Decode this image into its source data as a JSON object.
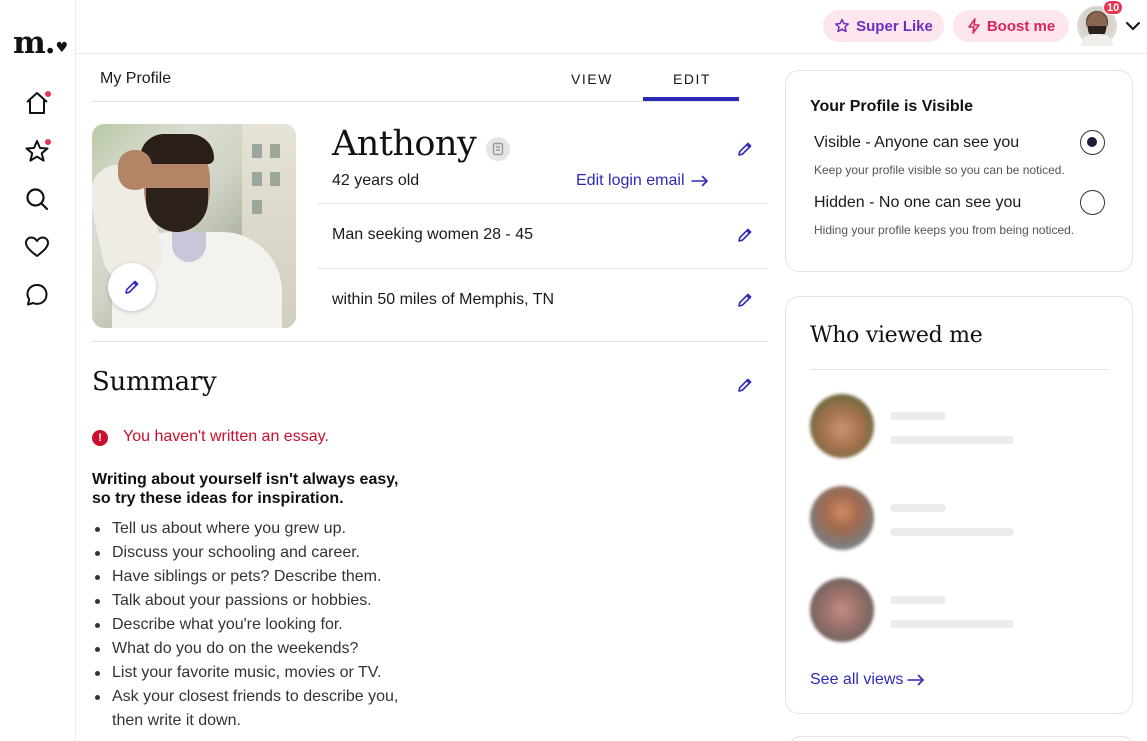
{
  "brand": {
    "logo": "m."
  },
  "topbar": {
    "super_like_label": "Super Like",
    "boost_label": "Boost me",
    "notification_count": "10"
  },
  "tabs": {
    "page_label": "My Profile",
    "view_label": "VIEW",
    "edit_label": "EDIT",
    "active": "EDIT"
  },
  "profile": {
    "name": "Anthony",
    "age": "42 years old",
    "login_email_link": "Edit login email",
    "seeking": "Man seeking women 28 - 45",
    "location": "within 50 miles of Memphis, TN"
  },
  "summary": {
    "title": "Summary",
    "warning": "You haven't written an essay.",
    "ideas_heading_line1": "Writing about yourself isn't always easy,",
    "ideas_heading_line2": "so try these ideas for inspiration.",
    "ideas": [
      "Tell us about where you grew up.",
      "Discuss your schooling and career.",
      "Have siblings or pets? Describe them.",
      "Talk about your passions or hobbies.",
      "Describe what you're looking for.",
      "What do you do on the weekends?",
      "List your favorite music, movies or TV.",
      "Ask your closest friends to describe you, then write it down."
    ]
  },
  "visibility": {
    "title": "Your Profile is Visible",
    "visible_label": "Visible - Anyone can see you",
    "visible_desc": "Keep your profile visible so you can be noticed.",
    "hidden_label": "Hidden - No one can see you",
    "hidden_desc": "Hiding your profile keeps you from being noticed.",
    "selected": "visible"
  },
  "viewers": {
    "title": "Who viewed me",
    "see_all": "See all views"
  },
  "colors": {
    "accent": "#2d2ab8",
    "notification": "#e8344f",
    "warning": "#c8102e",
    "super_like": "#6e2fc0",
    "boost": "#d8245c",
    "pill_bg": "#fde6ee"
  },
  "icons": {
    "nav": [
      "home-icon",
      "star-icon",
      "search-icon",
      "heart-icon",
      "chat-icon"
    ],
    "edit": "pencil-icon",
    "warning": "alert-circle-icon",
    "arrow": "arrow-right-icon"
  }
}
